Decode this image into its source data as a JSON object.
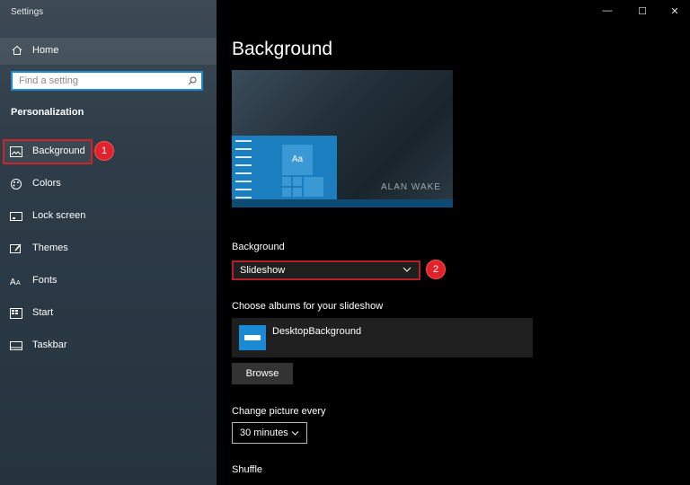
{
  "window": {
    "title": "Settings",
    "controls": [
      "—",
      "☐",
      "✕"
    ]
  },
  "sidebar": {
    "home_label": "Home",
    "search_placeholder": "Find a setting",
    "section_title": "Personalization",
    "items": [
      {
        "label": "Background",
        "icon": "image-icon",
        "active": true
      },
      {
        "label": "Colors",
        "icon": "palette-icon"
      },
      {
        "label": "Lock screen",
        "icon": "lock-screen-icon"
      },
      {
        "label": "Themes",
        "icon": "themes-icon"
      },
      {
        "label": "Fonts",
        "icon": "fonts-icon"
      },
      {
        "label": "Start",
        "icon": "start-icon"
      },
      {
        "label": "Taskbar",
        "icon": "taskbar-icon"
      }
    ]
  },
  "main": {
    "title": "Background",
    "preview": {
      "tile_text": "Aa",
      "logo_text": "ALAN WAKE"
    },
    "background_label": "Background",
    "background_value": "Slideshow",
    "albums_label": "Choose albums for your slideshow",
    "album_name": "DesktopBackground",
    "browse_label": "Browse",
    "change_label": "Change picture every",
    "change_value": "30 minutes",
    "shuffle_label": "Shuffle"
  },
  "annotations": {
    "badge1": "1",
    "badge2": "2",
    "color": "#e2222a"
  },
  "colors": {
    "accent": "#1a8ad4",
    "highlight": "#d0242b"
  }
}
